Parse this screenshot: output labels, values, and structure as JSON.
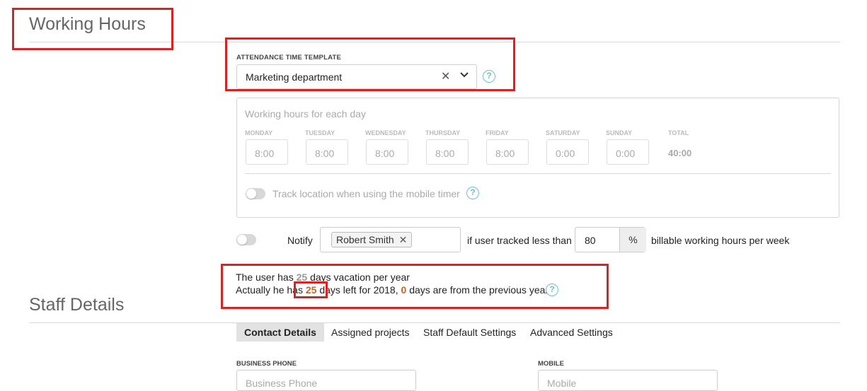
{
  "working_hours": {
    "title": "Working Hours",
    "template_label": "ATTENDANCE TIME TEMPLATE",
    "template_value": "Marketing department",
    "panel_heading": "Working hours for each day",
    "days": [
      {
        "label": "MONDAY",
        "value": "8:00"
      },
      {
        "label": "TUESDAY",
        "value": "8:00"
      },
      {
        "label": "WEDNESDAY",
        "value": "8:00"
      },
      {
        "label": "THURSDAY",
        "value": "8:00"
      },
      {
        "label": "FRIDAY",
        "value": "8:00"
      },
      {
        "label": "SATURDAY",
        "value": "0:00"
      },
      {
        "label": "SUNDAY",
        "value": "0:00"
      }
    ],
    "total_label": "TOTAL",
    "total_value": "40:00",
    "track_location_label": "Track location when using the mobile timer",
    "notify_label": "Notify",
    "notify_user_tag": "Robert Smith",
    "if_tracked_label": "if user tracked less than",
    "threshold_value": "80",
    "percent_symbol": "%",
    "billable_label": "billable working hours per week"
  },
  "vacation": {
    "line1_prefix": "The user has",
    "line1_days": "25",
    "line1_suffix": "days vacation per year",
    "line2_prefix": "Actually he has",
    "line2_days": "25",
    "line2_mid": "days left for 2018,",
    "line2_prev": "0",
    "line2_suffix": "days are from the previous year."
  },
  "staff_details": {
    "title": "Staff Details",
    "tabs": [
      "Contact Details",
      "Assigned projects",
      "Staff Default Settings",
      "Advanced Settings"
    ],
    "active_tab": "Contact Details",
    "business_phone_label": "BUSINESS PHONE",
    "business_phone_placeholder": "Business Phone",
    "mobile_label": "MOBILE",
    "mobile_placeholder": "Mobile"
  },
  "icons": {
    "help": "question-circle-icon",
    "clear": "close-icon",
    "dropdown": "chevron-down-icon",
    "tag_remove": "close-icon"
  },
  "colors": {
    "annotation_red": "#e02020",
    "help_blue": "#6bbfd0",
    "highlight_orange": "#c0672a"
  }
}
